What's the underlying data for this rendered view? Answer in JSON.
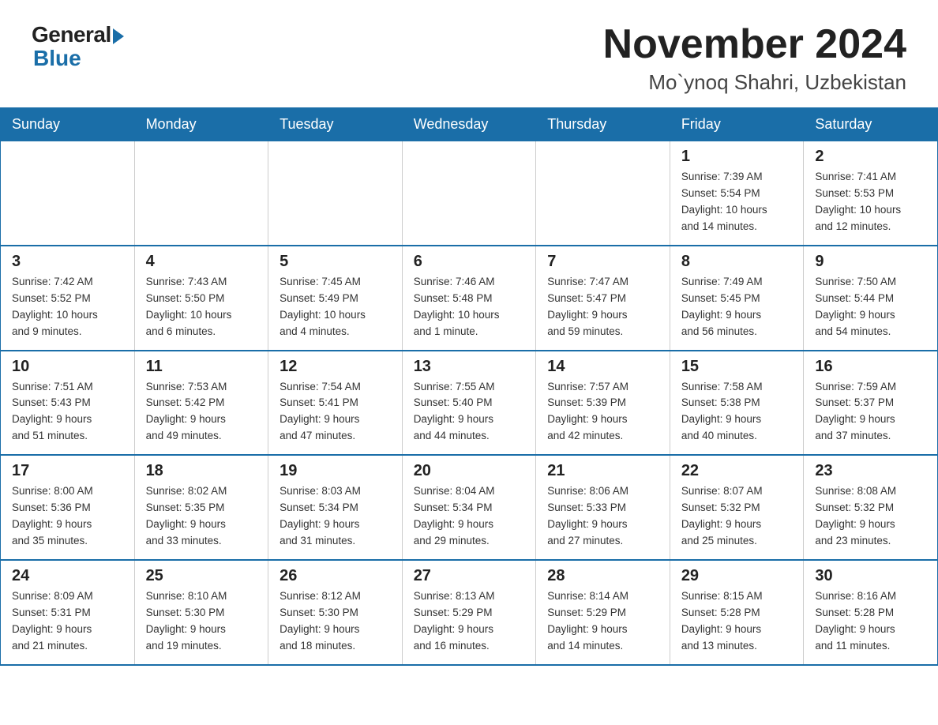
{
  "header": {
    "logo_general": "General",
    "logo_blue": "Blue",
    "title": "November 2024",
    "subtitle": "Mo`ynoq Shahri, Uzbekistan"
  },
  "calendar": {
    "days_of_week": [
      "Sunday",
      "Monday",
      "Tuesday",
      "Wednesday",
      "Thursday",
      "Friday",
      "Saturday"
    ],
    "weeks": [
      [
        {
          "num": "",
          "info": ""
        },
        {
          "num": "",
          "info": ""
        },
        {
          "num": "",
          "info": ""
        },
        {
          "num": "",
          "info": ""
        },
        {
          "num": "",
          "info": ""
        },
        {
          "num": "1",
          "info": "Sunrise: 7:39 AM\nSunset: 5:54 PM\nDaylight: 10 hours\nand 14 minutes."
        },
        {
          "num": "2",
          "info": "Sunrise: 7:41 AM\nSunset: 5:53 PM\nDaylight: 10 hours\nand 12 minutes."
        }
      ],
      [
        {
          "num": "3",
          "info": "Sunrise: 7:42 AM\nSunset: 5:52 PM\nDaylight: 10 hours\nand 9 minutes."
        },
        {
          "num": "4",
          "info": "Sunrise: 7:43 AM\nSunset: 5:50 PM\nDaylight: 10 hours\nand 6 minutes."
        },
        {
          "num": "5",
          "info": "Sunrise: 7:45 AM\nSunset: 5:49 PM\nDaylight: 10 hours\nand 4 minutes."
        },
        {
          "num": "6",
          "info": "Sunrise: 7:46 AM\nSunset: 5:48 PM\nDaylight: 10 hours\nand 1 minute."
        },
        {
          "num": "7",
          "info": "Sunrise: 7:47 AM\nSunset: 5:47 PM\nDaylight: 9 hours\nand 59 minutes."
        },
        {
          "num": "8",
          "info": "Sunrise: 7:49 AM\nSunset: 5:45 PM\nDaylight: 9 hours\nand 56 minutes."
        },
        {
          "num": "9",
          "info": "Sunrise: 7:50 AM\nSunset: 5:44 PM\nDaylight: 9 hours\nand 54 minutes."
        }
      ],
      [
        {
          "num": "10",
          "info": "Sunrise: 7:51 AM\nSunset: 5:43 PM\nDaylight: 9 hours\nand 51 minutes."
        },
        {
          "num": "11",
          "info": "Sunrise: 7:53 AM\nSunset: 5:42 PM\nDaylight: 9 hours\nand 49 minutes."
        },
        {
          "num": "12",
          "info": "Sunrise: 7:54 AM\nSunset: 5:41 PM\nDaylight: 9 hours\nand 47 minutes."
        },
        {
          "num": "13",
          "info": "Sunrise: 7:55 AM\nSunset: 5:40 PM\nDaylight: 9 hours\nand 44 minutes."
        },
        {
          "num": "14",
          "info": "Sunrise: 7:57 AM\nSunset: 5:39 PM\nDaylight: 9 hours\nand 42 minutes."
        },
        {
          "num": "15",
          "info": "Sunrise: 7:58 AM\nSunset: 5:38 PM\nDaylight: 9 hours\nand 40 minutes."
        },
        {
          "num": "16",
          "info": "Sunrise: 7:59 AM\nSunset: 5:37 PM\nDaylight: 9 hours\nand 37 minutes."
        }
      ],
      [
        {
          "num": "17",
          "info": "Sunrise: 8:00 AM\nSunset: 5:36 PM\nDaylight: 9 hours\nand 35 minutes."
        },
        {
          "num": "18",
          "info": "Sunrise: 8:02 AM\nSunset: 5:35 PM\nDaylight: 9 hours\nand 33 minutes."
        },
        {
          "num": "19",
          "info": "Sunrise: 8:03 AM\nSunset: 5:34 PM\nDaylight: 9 hours\nand 31 minutes."
        },
        {
          "num": "20",
          "info": "Sunrise: 8:04 AM\nSunset: 5:34 PM\nDaylight: 9 hours\nand 29 minutes."
        },
        {
          "num": "21",
          "info": "Sunrise: 8:06 AM\nSunset: 5:33 PM\nDaylight: 9 hours\nand 27 minutes."
        },
        {
          "num": "22",
          "info": "Sunrise: 8:07 AM\nSunset: 5:32 PM\nDaylight: 9 hours\nand 25 minutes."
        },
        {
          "num": "23",
          "info": "Sunrise: 8:08 AM\nSunset: 5:32 PM\nDaylight: 9 hours\nand 23 minutes."
        }
      ],
      [
        {
          "num": "24",
          "info": "Sunrise: 8:09 AM\nSunset: 5:31 PM\nDaylight: 9 hours\nand 21 minutes."
        },
        {
          "num": "25",
          "info": "Sunrise: 8:10 AM\nSunset: 5:30 PM\nDaylight: 9 hours\nand 19 minutes."
        },
        {
          "num": "26",
          "info": "Sunrise: 8:12 AM\nSunset: 5:30 PM\nDaylight: 9 hours\nand 18 minutes."
        },
        {
          "num": "27",
          "info": "Sunrise: 8:13 AM\nSunset: 5:29 PM\nDaylight: 9 hours\nand 16 minutes."
        },
        {
          "num": "28",
          "info": "Sunrise: 8:14 AM\nSunset: 5:29 PM\nDaylight: 9 hours\nand 14 minutes."
        },
        {
          "num": "29",
          "info": "Sunrise: 8:15 AM\nSunset: 5:28 PM\nDaylight: 9 hours\nand 13 minutes."
        },
        {
          "num": "30",
          "info": "Sunrise: 8:16 AM\nSunset: 5:28 PM\nDaylight: 9 hours\nand 11 minutes."
        }
      ]
    ]
  }
}
